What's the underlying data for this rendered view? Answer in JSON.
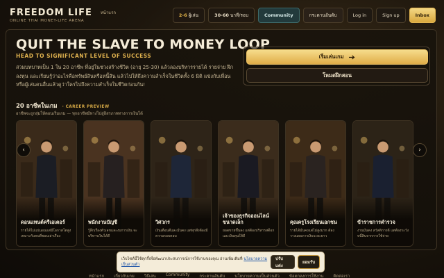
{
  "header": {
    "brand": "FREEDOM LIFE",
    "tagline": "ONLINE THAI MONEY-LIFE ARENA",
    "home_link": "หน้าแรก",
    "players_value": "2-6",
    "players_unit": "ผู้เล่น",
    "duration_value": "30-60",
    "duration_unit": "นาที/รอบ",
    "community": "Community",
    "board": "กระดานอันดับ",
    "login": "Log in",
    "signup": "Sign up",
    "inbox": "Inbox"
  },
  "hero": {
    "title": "QUIT THE SLAVE TO MONEY LOOP",
    "subtitle": "HEAD TO SIGNIFICANT LEVEL OF SUCCESS",
    "desc": "สวมบทบาทเป็น 1 ใน 20 อาชีพ ที่อยู่ในช่วงสร้างชีวิต (อายุ 25-30) แล้วลองบริหารรายได้ รายจ่าย ฝึกลงทุน และเรียนรู้ว่าอะไรคือทรัพย์สินหรือหนี้สิน แล้วไปให้ถึงความสำเร็จในชีวิตทั้ง 6 มิติ แข่งกับเพื่อนหรือผู้เล่นคนอื่นแล้วดูว่าใครไปถึงความสำเร็จในชีวิตก่อนกัน!",
    "start_button": "เริ่มเล่นเกม",
    "tutorial_button": "โหมดฝึกสอน"
  },
  "preview": {
    "heading": "20 อาชีพในเกม",
    "tag": "· CAREER PREVIEW",
    "note": "อาชีพจะถูกสุ่มให้ตอนเริ่มเกม — ทุกอาชีพมีทางไปสู่อิสรภาพทางการเงินได้"
  },
  "careers": [
    {
      "title": "ดอนแทนต์ครีเอเตอร์",
      "desc": "รายได้ไม่แน่นอนแต่มีโอกาสโตสูง เหมาะกับคนที่ชอบเล่าเรื่อง",
      "bg": "#3a2a1a",
      "outfit": "#1b1d24"
    },
    {
      "title": "พนักงานบัญชี",
      "desc": "รู้ลึกเรื่องตัวเลขและงบการเงิน จะบริหารเงินได้ดี",
      "bg": "#4a3320",
      "outfit": "#262020"
    },
    {
      "title": "วิศวกร",
      "desc": "เงินเดือนดีและมั่นคง แต่ทุกสิ่งต้องมีความรอบคอบ",
      "bg": "#2e2418",
      "outfit": "#1e2638"
    },
    {
      "title": "เจ้าของธุรกิจออนไลน์ขนาดเล็ก",
      "desc": "ยอดขายขึ้นลง แต่ต้องบริหารสต็อกและเงินทุนให้ดี",
      "bg": "#3b2c1c",
      "outfit": "#1a1a22"
    },
    {
      "title": "คุณครูโรงเรียนเอกชน",
      "desc": "รายได้มั่นคงแต่ไม่สูงมาก ต้องวางแผนการเงินระยะยาว",
      "bg": "#3d2b18",
      "outfit": "#2a2320"
    },
    {
      "title": "ข้าราชการตำรวจ",
      "desc": "งานมั่นคง สวัสดิการดี แต่ต้องระวังหนี้สินจากการใช้จ่าย",
      "bg": "#2c2317",
      "outfit": "#1a2030"
    }
  ],
  "cookie": {
    "text": "เว็บไซต์นี้ใช้คุกกี้เพื่อพัฒนาประสบการณ์การใช้งานของคุณ อ่านเพิ่มเติมที่",
    "link": "นโยบายความเป็นส่วนตัว",
    "settings": "ปรับแต่ง",
    "accept": "ยอมรับ"
  },
  "footer": {
    "links": [
      "หน้าแรก",
      "เกี่ยวกับเกม",
      "วิธีเล่น",
      "Community",
      "กระดานอันดับ",
      "นโยบายความเป็นส่วนตัว",
      "ข้อตกลงการใช้งาน",
      "ติดต่อเรา"
    ]
  },
  "nav": {
    "prev": "‹",
    "next": "›"
  }
}
